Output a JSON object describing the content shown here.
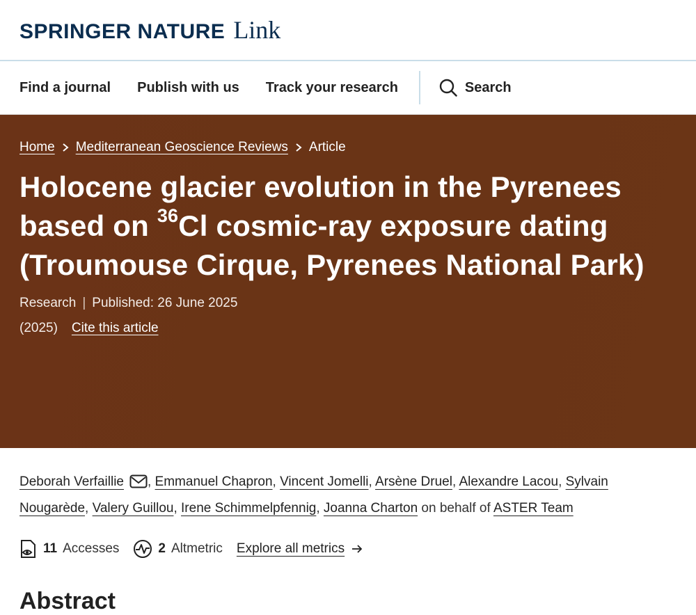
{
  "header": {
    "brand": "SPRINGER NATURE",
    "brand_link": "Link"
  },
  "nav": {
    "items": [
      "Find a journal",
      "Publish with us",
      "Track your research"
    ],
    "search_label": "Search"
  },
  "breadcrumb": {
    "home": "Home",
    "journal": "Mediterranean Geoscience Reviews",
    "current": "Article"
  },
  "article": {
    "title_line1": "Holocene glacier evolution in the Pyrenees",
    "title_line2_before": "based on ",
    "title_sup": "36",
    "title_line2_after": "Cl cosmic-ray exposure dating",
    "title_line3": "(Troumouse Cirque, Pyrenees National Park)",
    "type": "Research",
    "published": "Published: 26 June 2025",
    "year": "(2025)",
    "cite": "Cite this article"
  },
  "authors": {
    "list": [
      "Deborah Verfaillie",
      "Emmanuel Chapron",
      "Vincent Jomelli",
      "Arsène Druel",
      "Alexandre Lacou",
      "Sylvain Nougarède",
      "Valery Guillou",
      "Irene Schimmelpfennig",
      "Joanna Charton"
    ],
    "behalf_text": "on behalf of",
    "group": "ASTER Team"
  },
  "metrics": {
    "accesses_count": "11",
    "accesses_label": "Accesses",
    "altmetric_count": "2",
    "altmetric_label": "Altmetric",
    "explore_label": "Explore all metrics"
  },
  "abstract": {
    "heading": "Abstract"
  }
}
